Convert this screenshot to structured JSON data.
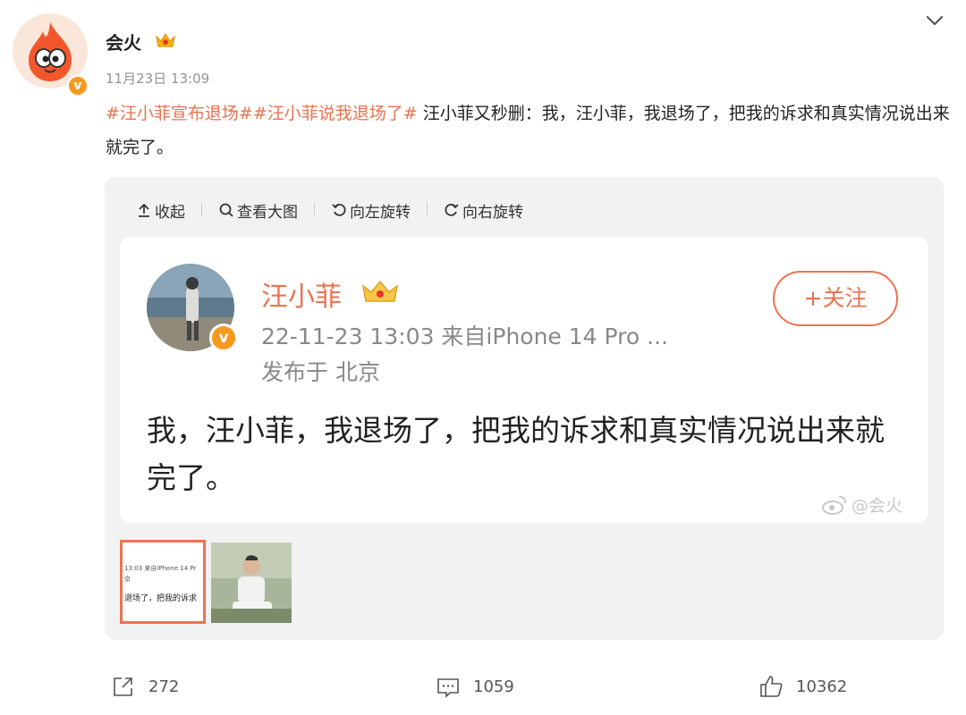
{
  "poster": {
    "name": "会火",
    "badge": "v",
    "time": "11月23日 13:09"
  },
  "post": {
    "tags": [
      "#汪小菲宣布退场#",
      "#汪小菲说我退场了#"
    ],
    "text": " 汪小菲又秒删：我，汪小菲，我退场了，把我的诉求和真实情况说出来就完了。"
  },
  "toolbar": {
    "collapse": "收起",
    "view_large": "查看大图",
    "rotate_left": "向左旋转",
    "rotate_right": "向右旋转"
  },
  "screenshot": {
    "name": "汪小菲",
    "badge": "v",
    "meta": "22-11-23 13:03  来自iPhone 14 Pro ...",
    "location": "发布于 北京",
    "follow": "+关注",
    "text": "我，汪小菲，我退场了，把我的诉求和真实情况说出来就完了。",
    "watermark": "@会火"
  },
  "thumbnails": {
    "first": {
      "line1": "13:03  来自iPhone 14 Pr",
      "line2": "京",
      "line3": "退场了，把我的诉求"
    }
  },
  "actions": {
    "share": "272",
    "comment": "1059",
    "like": "10362"
  },
  "colors": {
    "accent": "#eb7350",
    "badge": "#f59a1d",
    "panel": "#f2f2f2"
  }
}
